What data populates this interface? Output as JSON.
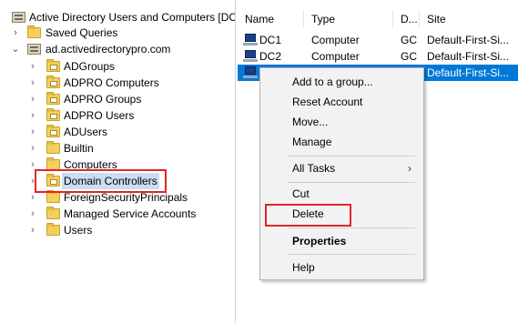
{
  "tree": {
    "root_label": "Active Directory Users and Computers [DC",
    "saved_queries": "Saved Queries",
    "domain": "ad.activedirectorypro.com",
    "ous": [
      "ADGroups",
      "ADPRO Computers",
      "ADPRO Groups",
      "ADPRO Users",
      "ADUsers",
      "Builtin",
      "Computers",
      "Domain Controllers",
      "ForeignSecurityPrincipals",
      "Managed Service Accounts",
      "Users"
    ]
  },
  "list": {
    "headers": {
      "name": "Name",
      "type": "Type",
      "dc": "D...",
      "site": "Site"
    },
    "rows": [
      {
        "name": "DC1",
        "type": "Computer",
        "dc": "GC",
        "site": "Default-First-Si..."
      },
      {
        "name": "DC2",
        "type": "Computer",
        "dc": "GC",
        "site": "Default-First-Si..."
      },
      {
        "name": "",
        "type": "",
        "dc": "",
        "site": "Default-First-Si..."
      }
    ]
  },
  "context_menu": {
    "add_to_group": "Add to a group...",
    "reset_account": "Reset Account",
    "move": "Move...",
    "manage": "Manage",
    "all_tasks": "All Tasks",
    "cut": "Cut",
    "delete": "Delete",
    "properties": "Properties",
    "help": "Help"
  },
  "colors": {
    "highlight_box": "#e0262a",
    "selection": "#0078d7",
    "folder": "#f4cf5b"
  }
}
